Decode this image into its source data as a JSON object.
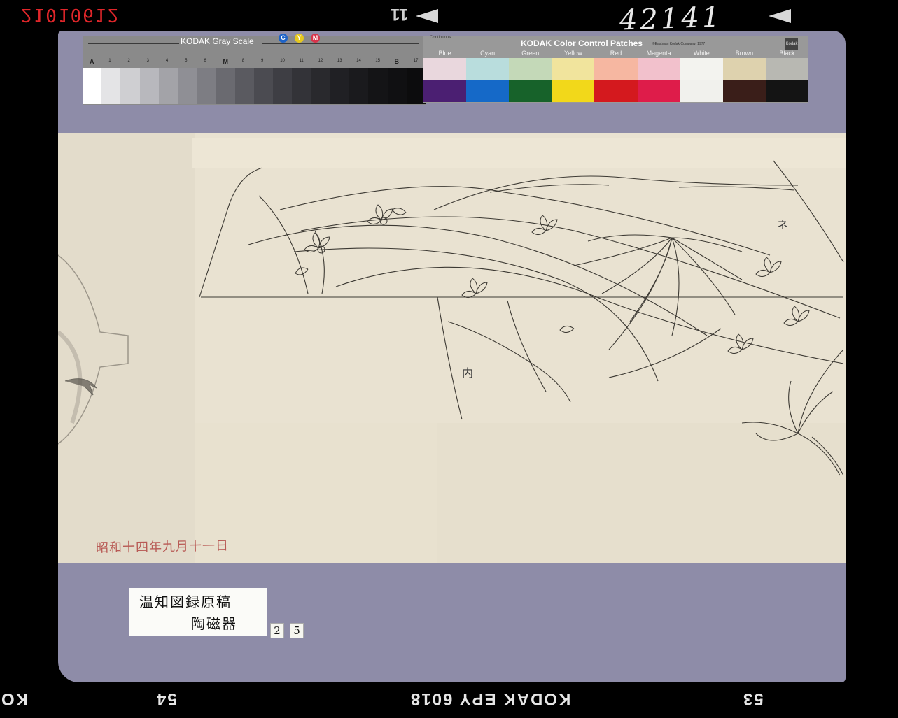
{
  "edge": {
    "code": "21010612",
    "frame": "11",
    "handwritten_number": "42141"
  },
  "gray_scale": {
    "title": "KODAK Gray Scale",
    "cmy": [
      {
        "letter": "C",
        "color": "#1e63c7"
      },
      {
        "letter": "Y",
        "color": "#e6c81e"
      },
      {
        "letter": "M",
        "color": "#d8334a"
      }
    ],
    "labels": [
      "A",
      "1",
      "2",
      "3",
      "4",
      "5",
      "6",
      "M",
      "8",
      "9",
      "10",
      "11",
      "12",
      "13",
      "14",
      "15",
      "B",
      "17"
    ],
    "patch_colors": [
      "#ffffff",
      "#e4e4e6",
      "#cfcfd2",
      "#b8b8bd",
      "#a3a3a8",
      "#8f8f95",
      "#7d7d83",
      "#6a6a70",
      "#5a5a60",
      "#4b4b51",
      "#3e3e44",
      "#333338",
      "#29292d",
      "#202024",
      "#1a1a1d",
      "#141416",
      "#101012",
      "#0c0c0d"
    ]
  },
  "color_control": {
    "corner_note": "Continuous",
    "title": "KODAK Color Control Patches",
    "copyright": "©Eastman Kodak Company, 1977",
    "logo": "Kodak",
    "patches": [
      {
        "name": "Blue",
        "light": "#e9d7dd",
        "dark": "#4b1f72"
      },
      {
        "name": "Cyan",
        "light": "#b9dddd",
        "dark": "#1569c8"
      },
      {
        "name": "Green",
        "light": "#c4d9b8",
        "dark": "#17622a"
      },
      {
        "name": "Yellow",
        "light": "#f1e49d",
        "dark": "#f2d81a"
      },
      {
        "name": "Red",
        "light": "#f6b7a1",
        "dark": "#d4191e"
      },
      {
        "name": "Magenta",
        "light": "#f2c1cc",
        "dark": "#de1c4a"
      },
      {
        "name": "White",
        "light": "#f3f3ef",
        "dark": "#f1f1ed"
      },
      {
        "name": "Brown",
        "light": "#ded2ae",
        "dark": "#3a1e19"
      },
      {
        "name": "Black",
        "light": "#b8b8b2",
        "dark": "#141414"
      }
    ]
  },
  "artwork": {
    "seal_top_right": "ネ",
    "seal_center": "内",
    "red_inscription": "昭和十四年九月十一日"
  },
  "label": {
    "line1": "温知図録原稿",
    "line2": "陶磁器",
    "numbers": [
      "2",
      "5"
    ]
  },
  "film_edge": {
    "left": "KO",
    "frame_54": "54",
    "stock": "KODAK EPY 6018",
    "frame_53": "53"
  }
}
